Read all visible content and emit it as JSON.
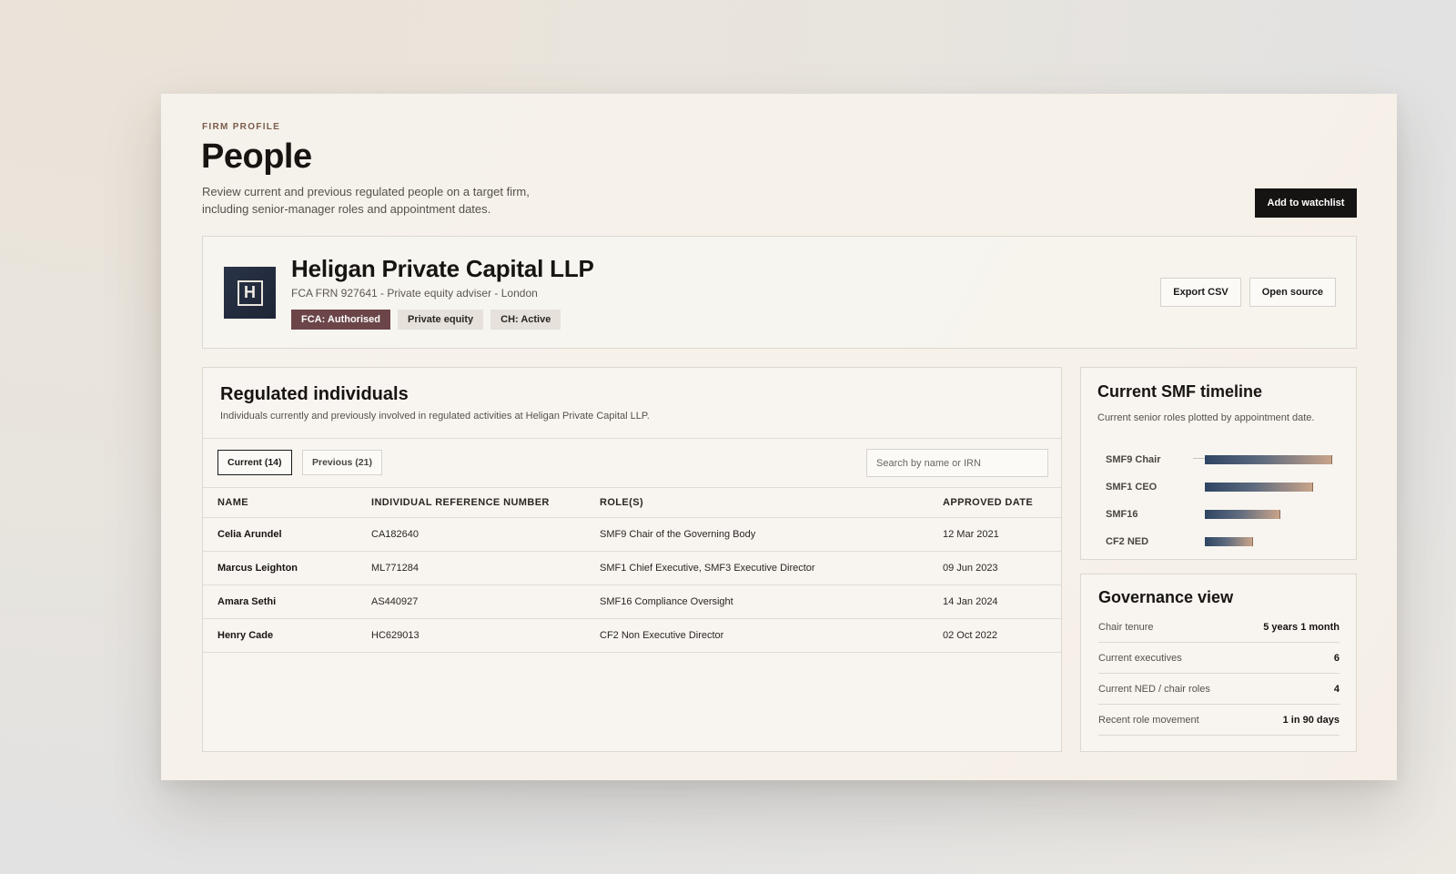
{
  "header": {
    "eyebrow": "FIRM PROFILE",
    "title": "People",
    "description": "Review current and previous regulated people on a target firm, including senior-manager roles and appointment dates.",
    "watchlist_label": "Add to watchlist"
  },
  "firm": {
    "logo_letter": "H",
    "name": "Heligan Private Capital LLP",
    "meta": "FCA FRN 927641 - Private equity adviser - London",
    "tags": [
      "FCA: Authorised",
      "Private equity",
      "CH: Active"
    ],
    "export_label": "Export CSV",
    "open_source_label": "Open source"
  },
  "regulated": {
    "title": "Regulated individuals",
    "subtitle": "Individuals currently and previously involved in regulated activities at Heligan Private Capital LLP.",
    "tabs": [
      {
        "label": "Current (14)",
        "active": true
      },
      {
        "label": "Previous (21)",
        "active": false
      }
    ],
    "search_placeholder": "Search by name or IRN",
    "columns": [
      "NAME",
      "INDIVIDUAL REFERENCE NUMBER",
      "ROLE(S)",
      "APPROVED DATE"
    ],
    "rows": [
      {
        "name": "Celia Arundel",
        "irn": "CA182640",
        "roles": "SMF9 Chair of the Governing Body",
        "date": "12 Mar 2021"
      },
      {
        "name": "Marcus Leighton",
        "irn": "ML771284",
        "roles": "SMF1 Chief Executive, SMF3 Executive Director",
        "date": "09 Jun 2023"
      },
      {
        "name": "Amara Sethi",
        "irn": "AS440927",
        "roles": "SMF16 Compliance Oversight",
        "date": "14 Jan 2024"
      },
      {
        "name": "Henry Cade",
        "irn": "HC629013",
        "roles": "CF2 Non Executive Director",
        "date": "02 Oct 2022"
      }
    ]
  },
  "smf_timeline": {
    "title": "Current SMF timeline",
    "subtitle": "Current senior roles plotted by appointment date.",
    "items": [
      {
        "label": "SMF9 Chair",
        "fill": 1.0
      },
      {
        "label": "SMF1 CEO",
        "fill": 0.85
      },
      {
        "label": "SMF16",
        "fill": 0.59
      },
      {
        "label": "CF2 NED",
        "fill": 0.38
      }
    ],
    "bar_colors": [
      "#2f4563",
      "#c8a48a"
    ]
  },
  "governance": {
    "title": "Governance view",
    "rows": [
      {
        "label": "Chair tenure",
        "value": "5 years 1 month"
      },
      {
        "label": "Current executives",
        "value": "6"
      },
      {
        "label": "Current NED / chair roles",
        "value": "4"
      },
      {
        "label": "Recent role movement",
        "value": "1 in 90 days"
      }
    ]
  },
  "colors": {
    "primary_tag": "#6b4548",
    "dark_button": "#161413",
    "logo_bg": "#2a3448"
  }
}
